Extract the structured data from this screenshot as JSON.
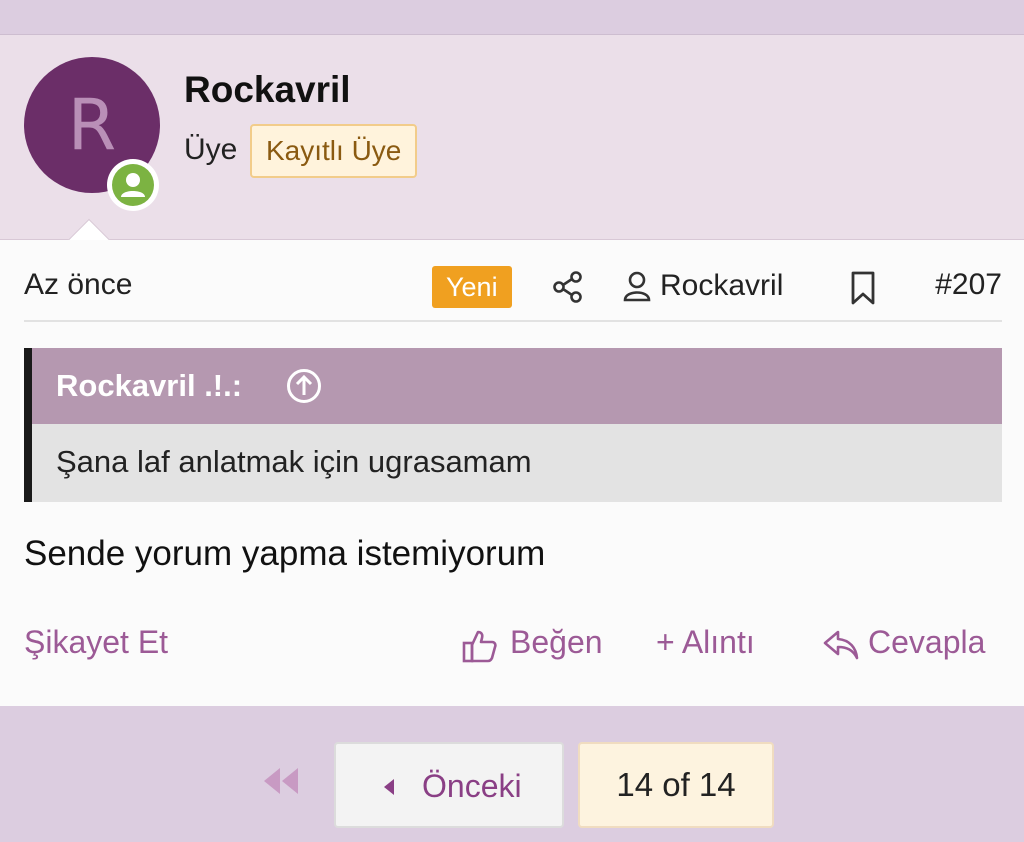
{
  "user": {
    "avatar_letter": "R",
    "name": "Rockavril",
    "title": "Üye",
    "badge": "Kayıtlı Üye"
  },
  "post": {
    "time": "Az önce",
    "new_label": "Yeni",
    "author": "Rockavril",
    "number": "#207",
    "quote": {
      "author": "Rockavril .!.:",
      "text": "Şana laf anlatmak için ugrasamam"
    },
    "message": "Sende yorum yapma istemiyorum"
  },
  "actions": {
    "report": "Şikayet Et",
    "like": "Beğen",
    "quote": "+ Alıntı",
    "reply": "Cevapla"
  },
  "pagination": {
    "prev_label": "Önceki",
    "current": "14 of 14"
  },
  "colors": {
    "page_bg": "#dccde0",
    "user_block_bg": "#ebdfe9",
    "avatar_bg": "#6b2e68",
    "online": "#7cb342",
    "accent": "#9c5a96",
    "quote_header": "#b598b0",
    "new_badge": "#f0a020"
  }
}
